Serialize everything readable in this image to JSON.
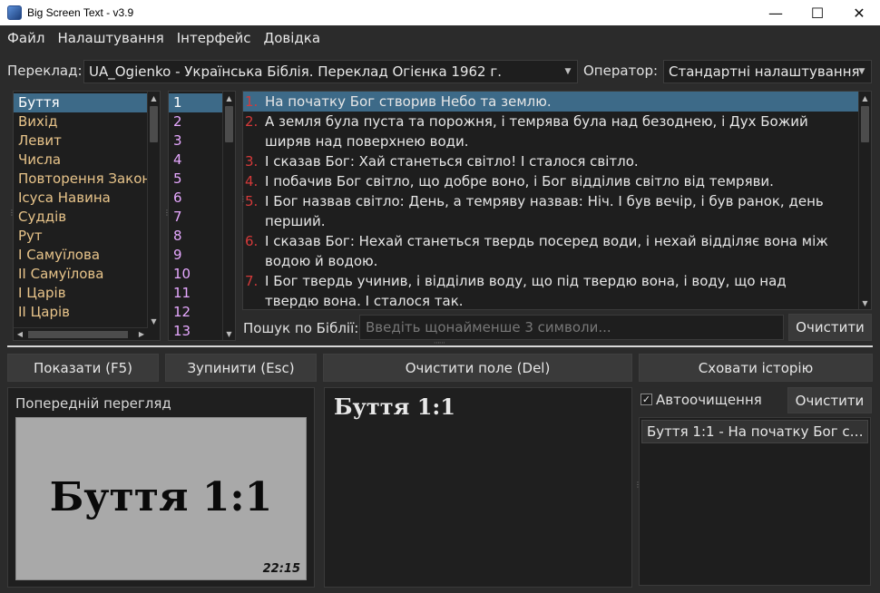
{
  "window": {
    "title": "Big Screen Text - v3.9"
  },
  "menu": {
    "file": "Файл",
    "settings": "Налаштування",
    "interface": "Інтерфейс",
    "help": "Довідка"
  },
  "translation": {
    "label": "Переклад:",
    "value": "UA_Ogienko - Українська Біблія. Переклад Огієнка 1962 г."
  },
  "operator": {
    "label": "Оператор:",
    "value": "Стандартні налаштування"
  },
  "books": [
    {
      "name": "Буття",
      "color": "#ffffff",
      "selected": true
    },
    {
      "name": "Вихід",
      "color": "#e8c48a"
    },
    {
      "name": "Левит",
      "color": "#e8c48a"
    },
    {
      "name": "Числа",
      "color": "#e8c48a"
    },
    {
      "name": "Повторення Закону",
      "color": "#e8c48a"
    },
    {
      "name": "Ісуса Навина",
      "color": "#e8c48a"
    },
    {
      "name": "Суддів",
      "color": "#e8c48a"
    },
    {
      "name": "Рут",
      "color": "#e8c48a"
    },
    {
      "name": "I Самуїлова",
      "color": "#e8c48a"
    },
    {
      "name": "II Самуїлова",
      "color": "#e8c48a"
    },
    {
      "name": "I Царів",
      "color": "#e8c48a"
    },
    {
      "name": "II Царів",
      "color": "#e8c48a"
    }
  ],
  "chapters": [
    "1",
    "2",
    "3",
    "4",
    "5",
    "6",
    "7",
    "8",
    "9",
    "10",
    "11",
    "12",
    "13"
  ],
  "chapter_color": "#e6a8ff",
  "verses": [
    {
      "num": "1.",
      "text": "На початку Бог створив Небо та землю.",
      "selected": true
    },
    {
      "num": "2.",
      "text": "А земля була пуста та порожня, і темрява була над безоднею, і Дух Божий ширяв над поверхнею води."
    },
    {
      "num": "3.",
      "text": "І сказав Бог: Хай станеться світло! І сталося світло."
    },
    {
      "num": "4.",
      "text": "І побачив Бог світло, що добре воно, і Бог відділив світло від темряви."
    },
    {
      "num": "5.",
      "text": "І Бог назвав світло: День, а темряву назвав: Ніч. І був вечір, і був ранок, день перший."
    },
    {
      "num": "6.",
      "text": "І сказав Бог: Нехай станеться твердь посеред води, і нехай відділяє вона між водою й водою."
    },
    {
      "num": "7.",
      "text": "І Бог твердь учинив, і відділив воду, що під твердю вона, і воду, що над твердю вона. І сталося так."
    }
  ],
  "search": {
    "label": "Пошук по Біблії:",
    "placeholder": "Введіть щонайменше 3 символи...",
    "clear": "Очистити"
  },
  "actions": {
    "show": "Показати (F5)",
    "stop": "Зупинити (Esc)",
    "clear_field": "Очистити поле (Del)",
    "hide_history": "Сховати історію"
  },
  "preview": {
    "title": "Попередній перегляд",
    "reference": "Буття 1:1",
    "clock": "22:15"
  },
  "field": {
    "reference": "Буття 1:1"
  },
  "history": {
    "autoclear_label": "Автоочищення",
    "autoclear_checked": true,
    "check_mark": "✓",
    "clear": "Очистити",
    "items": [
      "Буття 1:1 - На початку Бог ст..."
    ]
  }
}
